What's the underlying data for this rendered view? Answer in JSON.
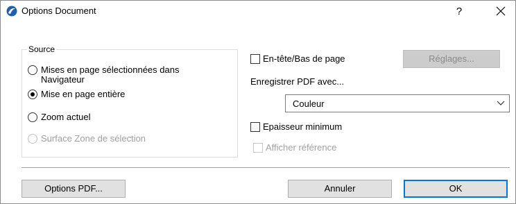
{
  "window": {
    "title": "Options Document",
    "help_label": "?",
    "close_label": "✕"
  },
  "source": {
    "legend": "Source",
    "options": [
      {
        "label": "Mises en page sélectionnées dans Navigateur",
        "selected": false,
        "enabled": true
      },
      {
        "label": "Mise en page entière",
        "selected": true,
        "enabled": true
      },
      {
        "label": "Zoom actuel",
        "selected": false,
        "enabled": true
      },
      {
        "label": "Surface Zone de sélection",
        "selected": false,
        "enabled": false
      }
    ]
  },
  "header_footer": {
    "label": "En-tête/Bas de page",
    "checked": false,
    "settings_button": "Réglages..."
  },
  "save_pdf": {
    "label": "Enregistrer PDF avec...",
    "selected_value": "Couleur"
  },
  "min_thickness": {
    "label": "Epaisseur minimum",
    "checked": false
  },
  "show_reference": {
    "label": "Afficher référence",
    "checked": false,
    "enabled": false
  },
  "footer": {
    "pdf_options": "Options PDF...",
    "cancel": "Annuler",
    "ok": "OK"
  },
  "colors": {
    "accent": "#0078d7",
    "disabled_text": "#a0a0a0"
  }
}
